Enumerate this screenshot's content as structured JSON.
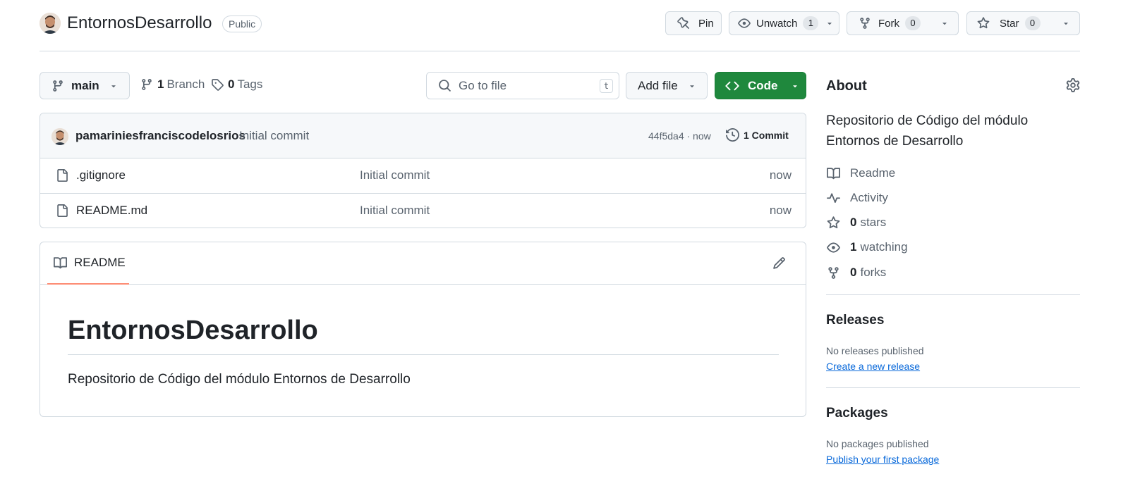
{
  "repo": {
    "name": "EntornosDesarrollo",
    "visibility": "Public"
  },
  "actions": {
    "pin": "Pin",
    "watch": {
      "label": "Unwatch",
      "count": "1"
    },
    "fork": {
      "label": "Fork",
      "count": "0"
    },
    "star": {
      "label": "Star",
      "count": "0"
    }
  },
  "toolbar": {
    "branch": "main",
    "branches_count": "1",
    "branches_label": "Branch",
    "tags_count": "0",
    "tags_label": "Tags",
    "goto_placeholder": "Go to file",
    "goto_shortcut": "t",
    "add_file": "Add file",
    "code": "Code"
  },
  "latest_commit": {
    "author": "pamariniesfranciscodelosrios",
    "message": "Initial commit",
    "sha_age": "44f5da4 · now",
    "count": "1 Commit"
  },
  "files": [
    {
      "name": ".gitignore",
      "message": "Initial commit",
      "age": "now"
    },
    {
      "name": "README.md",
      "message": "Initial commit",
      "age": "now"
    }
  ],
  "readme": {
    "tab": "README",
    "heading": "EntornosDesarrollo",
    "body": "Repositorio de Código del módulo Entornos de Desarrollo"
  },
  "about": {
    "title": "About",
    "description": "Repositorio de Código del módulo Entornos de Desarrollo",
    "readme": "Readme",
    "activity": "Activity",
    "stars_count": "0",
    "stars_label": "stars",
    "watching_count": "1",
    "watching_label": "watching",
    "forks_count": "0",
    "forks_label": "forks"
  },
  "releases": {
    "title": "Releases",
    "empty": "No releases published",
    "link": "Create a new release"
  },
  "packages": {
    "title": "Packages",
    "empty": "No packages published",
    "link": "Publish your first package"
  },
  "colors": {
    "accent_green": "#1f883d",
    "link_blue": "#0969da",
    "tab_underline": "#fd8c73",
    "border": "#d1d9e0",
    "muted": "#59636e"
  }
}
